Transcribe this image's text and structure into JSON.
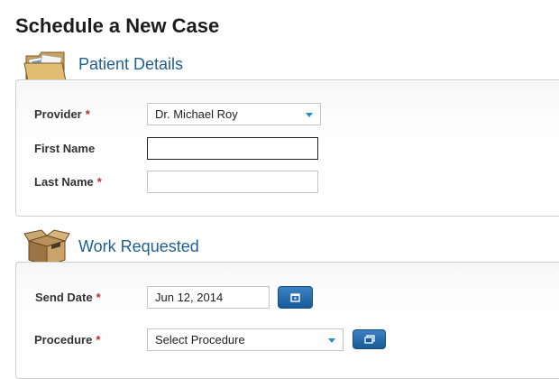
{
  "page_title": "Schedule a New Case",
  "patient_details": {
    "heading": "Patient Details",
    "icon": "folder-icon",
    "provider_label": "Provider",
    "provider_value": "Dr. Michael Roy",
    "first_name_label": "First Name",
    "first_name_value": "",
    "last_name_label": "Last Name",
    "last_name_value": "",
    "required_marker": "*"
  },
  "work_requested": {
    "heading": "Work Requested",
    "icon": "box-icon",
    "send_date_label": "Send Date",
    "send_date_value": "Jun 12, 2014",
    "procedure_label": "Procedure",
    "procedure_value": "Select Procedure",
    "required_marker": "*"
  },
  "colors": {
    "heading_blue": "#1f5f91",
    "required_red": "#c0282d",
    "button_blue": "#1a5a98",
    "caret_blue": "#1f8fc9"
  }
}
